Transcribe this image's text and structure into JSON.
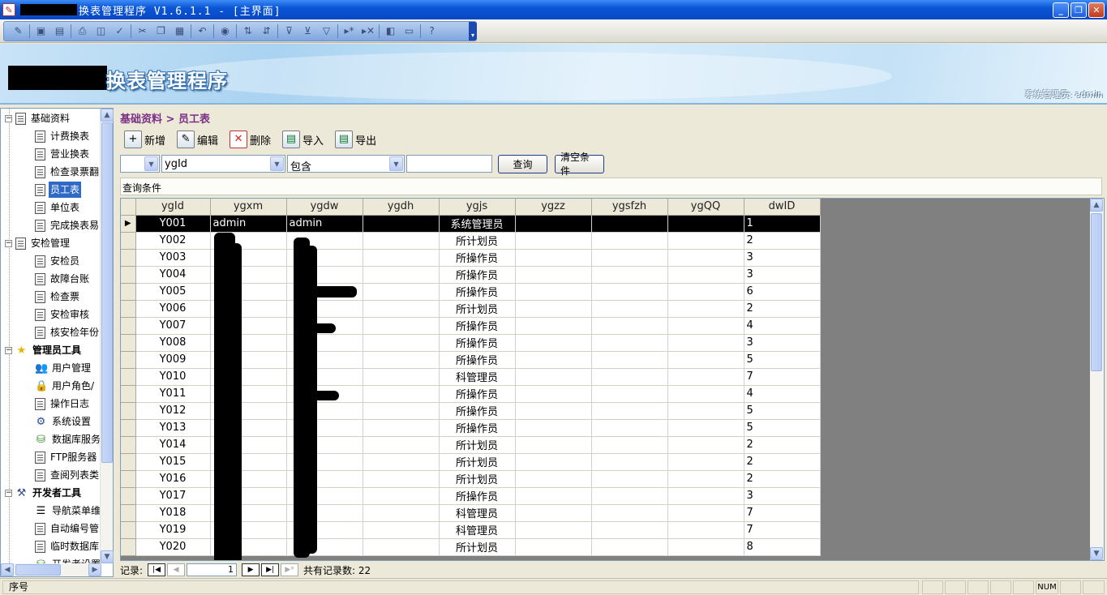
{
  "window": {
    "title": "换表管理程序 V1.6.1.1 - [主界面]",
    "buttons": {
      "minimize": "_",
      "restore": "❐",
      "close": "✕"
    }
  },
  "banner": {
    "title": "换表管理程序",
    "user_info": "系统管理员: admin"
  },
  "tree": [
    {
      "label": "基础资料",
      "level": 0,
      "icon": "document-icon",
      "expander": "−"
    },
    {
      "label": "计费换表",
      "level": 1,
      "icon": "document-icon"
    },
    {
      "label": "营业换表",
      "level": 1,
      "icon": "document-icon"
    },
    {
      "label": "检查录票翻",
      "level": 1,
      "icon": "document-icon"
    },
    {
      "label": "员工表",
      "level": 1,
      "icon": "document-icon",
      "selected": true
    },
    {
      "label": "单位表",
      "level": 1,
      "icon": "document-icon"
    },
    {
      "label": "完成换表易",
      "level": 1,
      "icon": "document-icon"
    },
    {
      "label": "安检管理",
      "level": 0,
      "icon": "document-icon",
      "expander": "−"
    },
    {
      "label": "安检员",
      "level": 1,
      "icon": "document-icon"
    },
    {
      "label": "故障台账",
      "level": 1,
      "icon": "document-icon"
    },
    {
      "label": "检查票",
      "level": 1,
      "icon": "document-icon"
    },
    {
      "label": "安检审核",
      "level": 1,
      "icon": "document-icon"
    },
    {
      "label": "核安检年份",
      "level": 1,
      "icon": "document-icon"
    },
    {
      "label": "管理员工具",
      "level": 0,
      "icon": "star-icon",
      "expander": "−",
      "bold": true
    },
    {
      "label": "用户管理",
      "level": 1,
      "icon": "users-icon"
    },
    {
      "label": "用户角色/",
      "level": 1,
      "icon": "lock-icon"
    },
    {
      "label": "操作日志",
      "level": 1,
      "icon": "document-icon"
    },
    {
      "label": "系统设置",
      "level": 1,
      "icon": "settings-icon"
    },
    {
      "label": "数据库服务",
      "level": 1,
      "icon": "database-icon"
    },
    {
      "label": "FTP服务器",
      "level": 1,
      "icon": "document-icon"
    },
    {
      "label": "查阅列表类",
      "level": 1,
      "icon": "document-icon"
    },
    {
      "label": "开发者工具",
      "level": 0,
      "icon": "tools-icon",
      "expander": "−",
      "bold": true
    },
    {
      "label": "导航菜单维",
      "level": 1,
      "icon": "list-icon"
    },
    {
      "label": "自动编号管",
      "level": 1,
      "icon": "document-icon"
    },
    {
      "label": "临时数据库",
      "level": 1,
      "icon": "document-icon"
    },
    {
      "label": "开发者设置",
      "level": 1,
      "icon": "database-icon"
    }
  ],
  "content": {
    "breadcrumb": "基础资料 > 员工表",
    "actions": [
      {
        "label": "新增",
        "icon": "add-icon"
      },
      {
        "label": "编辑",
        "icon": "edit-icon"
      },
      {
        "label": "删除",
        "icon": "delete-icon"
      },
      {
        "label": "导入",
        "icon": "import-icon"
      },
      {
        "label": "导出",
        "icon": "export-icon"
      }
    ],
    "filter": {
      "field_value": "ygId",
      "operator_value": "包含",
      "query_button": "查询",
      "clear_button": "清空条件"
    },
    "condition_label": "查询条件"
  },
  "grid": {
    "columns": [
      "ygId",
      "ygxm",
      "ygdw",
      "ygdh",
      "ygjs",
      "ygzz",
      "ygsfzh",
      "ygQQ",
      "dwID"
    ],
    "rows": [
      {
        "ygId": "Y001",
        "ygxm": "admin",
        "ygdw": "admin",
        "ygjs": "系统管理员",
        "dwID": "1"
      },
      {
        "ygId": "Y002",
        "ygxm": "",
        "ygdw": "",
        "ygjs": "所计划员",
        "dwID": "2"
      },
      {
        "ygId": "Y003",
        "ygxm": "",
        "ygdw": "",
        "ygjs": "所操作员",
        "dwID": "3"
      },
      {
        "ygId": "Y004",
        "ygxm": "",
        "ygdw": "",
        "ygjs": "所操作员",
        "dwID": "3"
      },
      {
        "ygId": "Y005",
        "ygxm": "",
        "ygdw": "",
        "ygjs": "所操作员",
        "dwID": "6"
      },
      {
        "ygId": "Y006",
        "ygxm": "",
        "ygdw": "",
        "ygjs": "所计划员",
        "dwID": "2"
      },
      {
        "ygId": "Y007",
        "ygxm": "",
        "ygdw": "",
        "ygjs": "所操作员",
        "dwID": "4"
      },
      {
        "ygId": "Y008",
        "ygxm": "",
        "ygdw": "",
        "ygjs": "所操作员",
        "dwID": "3"
      },
      {
        "ygId": "Y009",
        "ygxm": "",
        "ygdw": "",
        "ygjs": "所操作员",
        "dwID": "5"
      },
      {
        "ygId": "Y010",
        "ygxm": "",
        "ygdw": "",
        "ygjs": "科管理员",
        "dwID": "7"
      },
      {
        "ygId": "Y011",
        "ygxm": "",
        "ygdw": "",
        "ygjs": "所操作员",
        "dwID": "4"
      },
      {
        "ygId": "Y012",
        "ygxm": "",
        "ygdw": "",
        "ygjs": "所操作员",
        "dwID": "5"
      },
      {
        "ygId": "Y013",
        "ygxm": "",
        "ygdw": "",
        "ygjs": "所操作员",
        "dwID": "5"
      },
      {
        "ygId": "Y014",
        "ygxm": "",
        "ygdw": "",
        "ygjs": "所计划员",
        "dwID": "2"
      },
      {
        "ygId": "Y015",
        "ygxm": "",
        "ygdw": "",
        "ygjs": "所计划员",
        "dwID": "2"
      },
      {
        "ygId": "Y016",
        "ygxm": "",
        "ygdw": "",
        "ygjs": "所计划员",
        "dwID": "2"
      },
      {
        "ygId": "Y017",
        "ygxm": "",
        "ygdw": "",
        "ygjs": "所操作员",
        "dwID": "3"
      },
      {
        "ygId": "Y018",
        "ygxm": "",
        "ygdw": "",
        "ygjs": "科管理员",
        "dwID": "7"
      },
      {
        "ygId": "Y019",
        "ygxm": "",
        "ygdw": "",
        "ygjs": "科管理员",
        "dwID": "7"
      },
      {
        "ygId": "Y020",
        "ygxm": "",
        "ygdw": "",
        "ygjs": "所计划员",
        "dwID": "8"
      }
    ]
  },
  "navigator": {
    "label": "记录:",
    "current": "1",
    "total_label": "共有记录数: 22"
  },
  "statusbar": {
    "main": "序号",
    "num": "NUM"
  }
}
